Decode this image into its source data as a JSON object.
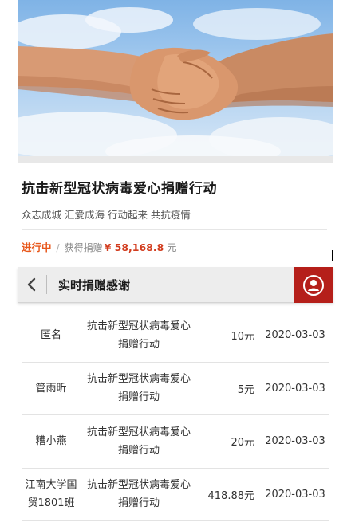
{
  "campaign": {
    "title": "抗击新型冠状病毒爱心捐赠行动",
    "subtitle": "众志成城 汇爱成海 行动起来 共抗疫情",
    "status_tag": "进行中",
    "separator": "/",
    "raised_label": "获得捐赠",
    "amount": "¥ 58,168.8",
    "unit": "元"
  },
  "navbar": {
    "title": "实时捐赠感谢",
    "back_icon": "chevron-left-icon",
    "user_icon": "user-icon",
    "accent_color": "#b51f1a"
  },
  "donations": [
    {
      "name": "匿名",
      "project_line1": "抗击新型冠状病毒爱心",
      "project_line2": "捐赠行动",
      "amount": "10元",
      "date": "2020-03-03"
    },
    {
      "name": "管雨昕",
      "project_line1": "抗击新型冠状病毒爱心",
      "project_line2": "捐赠行动",
      "amount": "5元",
      "date": "2020-03-03"
    },
    {
      "name": "糟小燕",
      "project_line1": "抗击新型冠状病毒爱心",
      "project_line2": "捐赠行动",
      "amount": "20元",
      "date": "2020-03-03"
    },
    {
      "name": "江南大学国贸1801班",
      "name_line1": "江南大学国",
      "name_line2": "贸1801班",
      "project_line1": "抗击新型冠状病毒爱心",
      "project_line2": "捐赠行动",
      "amount": "418.88元",
      "date": "2020-03-03"
    }
  ],
  "colors": {
    "status": "#e8581c",
    "amount": "#d23c1e"
  }
}
